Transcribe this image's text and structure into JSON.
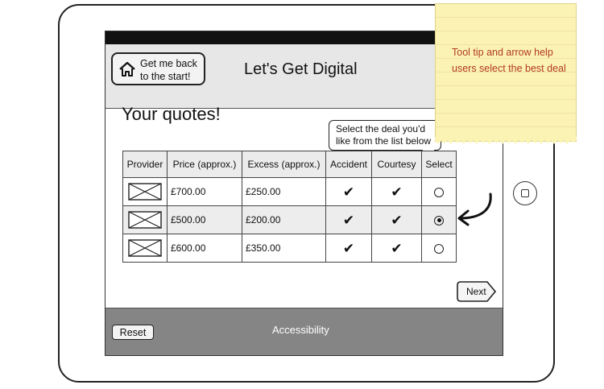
{
  "header": {
    "back_button": "Get me back\nto the start!",
    "title": "Let's Get Digital"
  },
  "main": {
    "heading": "Your quotes!",
    "tooltip": "Select the deal you'd\nlike from the list below",
    "table": {
      "headers": [
        "Provider",
        "Price (approx.)",
        "Excess (approx.)",
        "Accident",
        "Courtesy",
        "Select"
      ],
      "rows": [
        {
          "price": "£700.00",
          "excess": "£250.00",
          "accident": "✔",
          "courtesy": "✔",
          "selected": false
        },
        {
          "price": "£500.00",
          "excess": "£200.00",
          "accident": "✔",
          "courtesy": "✔",
          "selected": true
        },
        {
          "price": "£600.00",
          "excess": "£350.00",
          "accident": "✔",
          "courtesy": "✔",
          "selected": false
        }
      ]
    },
    "next_button": "Next"
  },
  "footer": {
    "reset_button": "Reset",
    "accessibility_link": "Accessibility"
  },
  "annotation": {
    "note": "Tool tip and arrow help users select the best deal"
  },
  "colors": {
    "header_bg": "#e7e7e7",
    "footer_bg": "#858585",
    "note_bg": "#fbf3b4",
    "note_text": "#b23a1d"
  },
  "icons": [
    "home-icon",
    "image-placeholder-icon",
    "checkmark-icon",
    "radio-icon",
    "curved-arrow-icon",
    "next-arrow-icon"
  ]
}
